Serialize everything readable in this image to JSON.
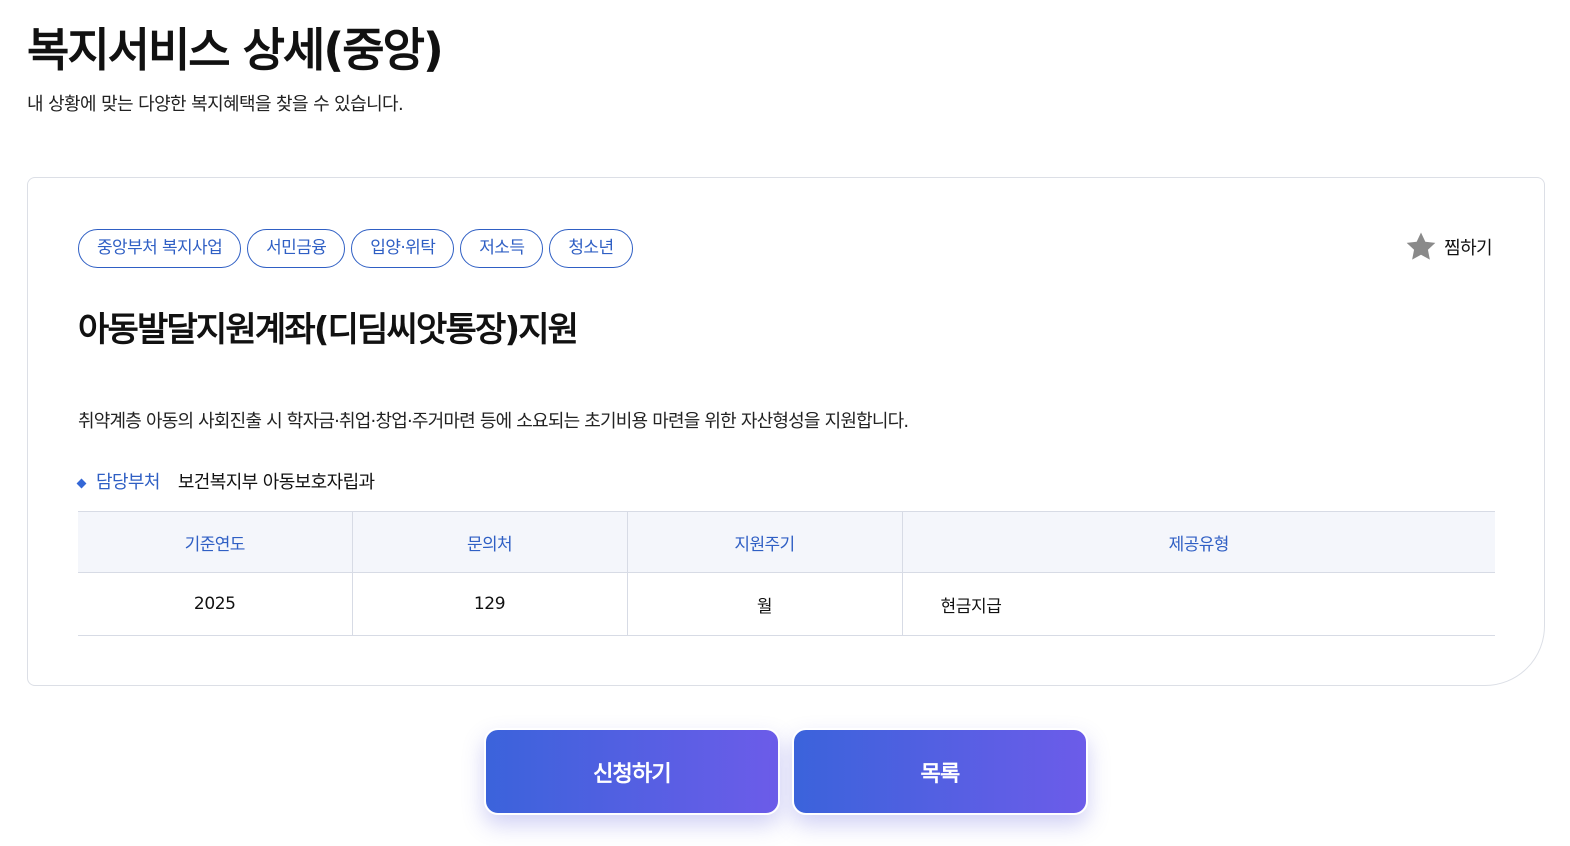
{
  "header": {
    "title": "복지서비스 상세(중앙)",
    "subtitle": "내 상황에 맞는 다양한 복지혜택을 찾을 수 있습니다."
  },
  "service": {
    "tags": [
      "중앙부처 복지사업",
      "서민금융",
      "입양·위탁",
      "저소득",
      "청소년"
    ],
    "bookmark_label": "찜하기",
    "bookmark_icon": "star-icon",
    "title": "아동발달지원계좌(디딤씨앗통장)지원",
    "description": "취약계층 아동의 사회진출 시 학자금·취업·창업·주거마련 등에 소요되는 초기비용 마련을 위한 자산형성을 지원합니다.",
    "department_label": "담당부처",
    "department_value": "보건복지부 아동보호자립과"
  },
  "table": {
    "headers": [
      "기준연도",
      "문의처",
      "지원주기",
      "제공유형"
    ],
    "row": [
      "2025",
      "129",
      "월",
      "현금지급"
    ]
  },
  "actions": {
    "apply_label": "신청하기",
    "list_label": "목록"
  },
  "colors": {
    "accent": "#2f5fc4",
    "button_gradient_start": "#3b63db",
    "button_gradient_end": "#6c5ce9",
    "table_header_bg": "#f4f6fb"
  }
}
